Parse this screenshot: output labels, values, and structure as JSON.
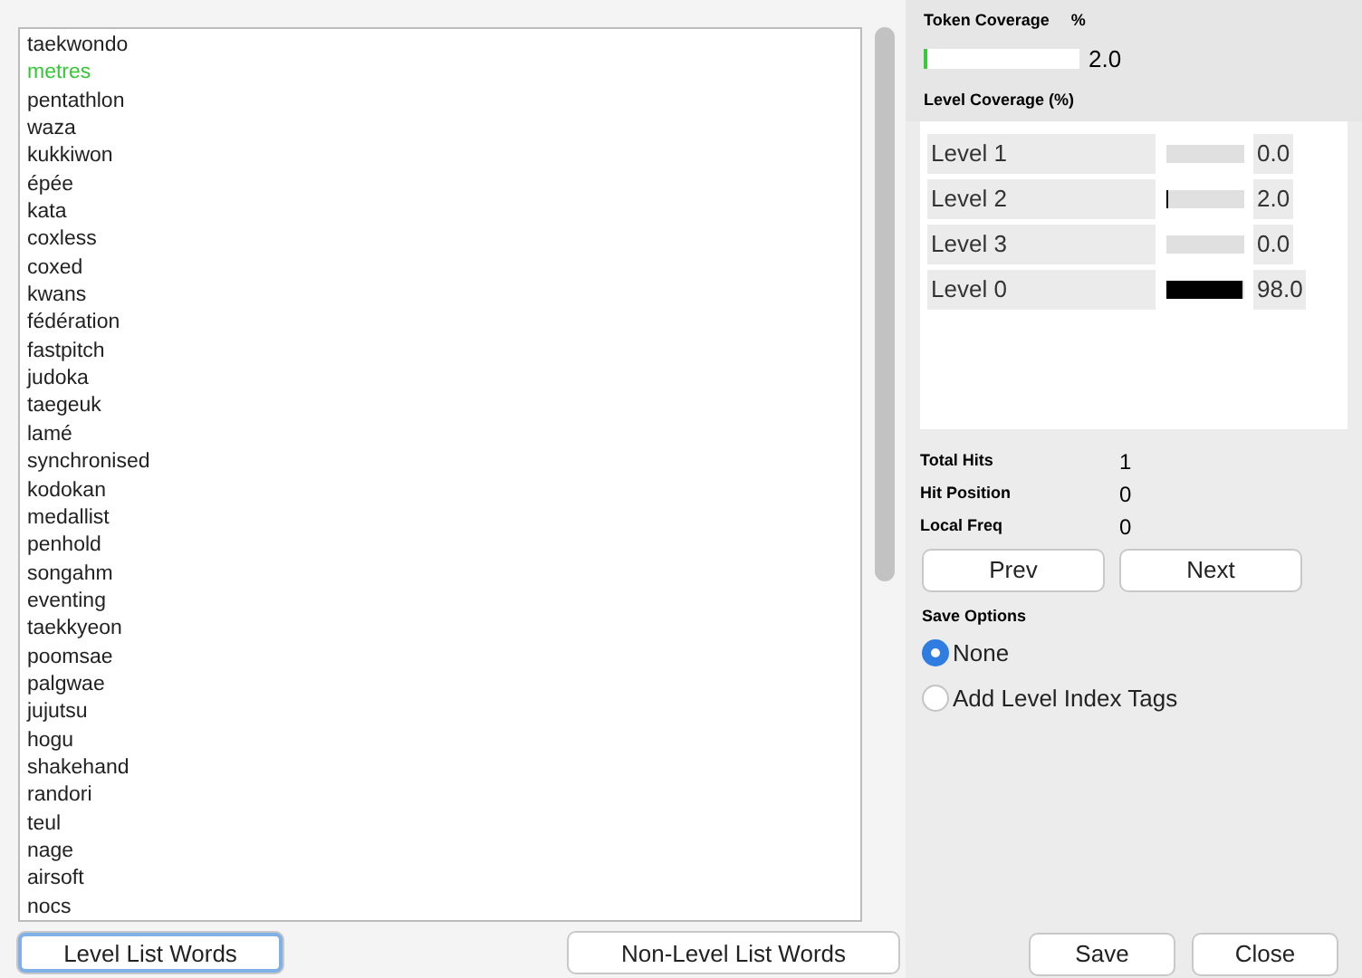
{
  "words": [
    {
      "text": "taekwondo",
      "highlighted": false
    },
    {
      "text": "metres",
      "highlighted": true
    },
    {
      "text": "pentathlon",
      "highlighted": false
    },
    {
      "text": "waza",
      "highlighted": false
    },
    {
      "text": "kukkiwon",
      "highlighted": false
    },
    {
      "text": "épée",
      "highlighted": false
    },
    {
      "text": "kata",
      "highlighted": false
    },
    {
      "text": "coxless",
      "highlighted": false
    },
    {
      "text": "coxed",
      "highlighted": false
    },
    {
      "text": "kwans",
      "highlighted": false
    },
    {
      "text": "fédération",
      "highlighted": false
    },
    {
      "text": "fastpitch",
      "highlighted": false
    },
    {
      "text": "judoka",
      "highlighted": false
    },
    {
      "text": "taegeuk",
      "highlighted": false
    },
    {
      "text": "lamé",
      "highlighted": false
    },
    {
      "text": "synchronised",
      "highlighted": false
    },
    {
      "text": "kodokan",
      "highlighted": false
    },
    {
      "text": "medallist",
      "highlighted": false
    },
    {
      "text": "penhold",
      "highlighted": false
    },
    {
      "text": "songahm",
      "highlighted": false
    },
    {
      "text": "eventing",
      "highlighted": false
    },
    {
      "text": "taekkyeon",
      "highlighted": false
    },
    {
      "text": "poomsae",
      "highlighted": false
    },
    {
      "text": "palgwae",
      "highlighted": false
    },
    {
      "text": "jujutsu",
      "highlighted": false
    },
    {
      "text": "hogu",
      "highlighted": false
    },
    {
      "text": "shakehand",
      "highlighted": false
    },
    {
      "text": "randori",
      "highlighted": false
    },
    {
      "text": "teul",
      "highlighted": false
    },
    {
      "text": "nage",
      "highlighted": false
    },
    {
      "text": "airsoft",
      "highlighted": false
    },
    {
      "text": "nocs",
      "highlighted": false
    }
  ],
  "list_buttons": [
    {
      "label": "Level List Words",
      "focused": true
    },
    {
      "label": "Non-Level List Words",
      "focused": false
    }
  ],
  "token_coverage": {
    "title": "Token Coverage",
    "unit": "%",
    "level": 0.02,
    "value": "2.0"
  },
  "level_coverage": {
    "title": "Level Coverage (%)",
    "rows": [
      {
        "label": "Level 1",
        "level": 0.0,
        "value": "0.0"
      },
      {
        "label": "Level 2",
        "level": 0.02,
        "value": "2.0"
      },
      {
        "label": "Level 3",
        "level": 0.0,
        "value": "0.0"
      },
      {
        "label": "Level 0",
        "level": 0.98,
        "value": "98.0"
      }
    ]
  },
  "stats": [
    {
      "label": "Total Hits",
      "value": "1"
    },
    {
      "label": "Hit Position",
      "value": "0"
    },
    {
      "label": "Local Freq",
      "value": "0"
    }
  ],
  "nav_buttons": [
    "Prev",
    "Next"
  ],
  "save_options": {
    "title": "Save Options",
    "options": [
      {
        "label": "None",
        "selected": true
      },
      {
        "label": "Add Level Index Tags",
        "selected": false
      }
    ]
  },
  "dialog_buttons": [
    "Save",
    "Close"
  ]
}
